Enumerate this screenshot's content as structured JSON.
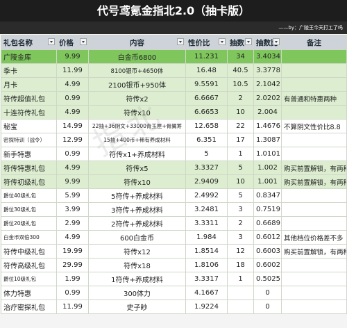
{
  "title": "代号鸢氪金指北2.0（抽卡版）",
  "credit": "——by：广陵王今天打工了吗",
  "headers": [
    "礼包名称",
    "价格",
    "内容",
    "性价比",
    "抽数",
    "抽数比",
    "备注"
  ],
  "rows": [
    {
      "name": "广陵金库",
      "price": "9.99",
      "content": "白金币6800",
      "value": "11.231",
      "pulls": "34",
      "ratio": "3.4034",
      "note": "",
      "style": "hl"
    },
    {
      "name": "季卡",
      "price": "11.99",
      "content": "8100银币+4650体",
      "value": "16.48",
      "pulls": "40.5",
      "ratio": "3.3778",
      "note": "",
      "style": "g"
    },
    {
      "name": "月卡",
      "price": "4.99",
      "content": "2100银币+950体",
      "value": "9.5591",
      "pulls": "10.5",
      "ratio": "2.1042",
      "note": "",
      "style": "g"
    },
    {
      "name": "符传超值礼包",
      "price": "0.99",
      "content": "符传x2",
      "value": "6.6667",
      "pulls": "2",
      "ratio": "2.0202",
      "note": "有普通和特惠两种",
      "style": "g"
    },
    {
      "name": "十连符传礼包",
      "price": "4.99",
      "content": "符传x10",
      "value": "6.6653",
      "pulls": "10",
      "ratio": "2.004",
      "note": "",
      "style": "g"
    },
    {
      "name": "秘宝",
      "price": "14.99",
      "content": "22抽+36阴文+33000青玉匣+骨翼筹",
      "value": "12.658",
      "pulls": "22",
      "ratio": "1.4676",
      "note": "不算阴文性价比8.8",
      "style": "w"
    },
    {
      "name": "密探特训（战令）",
      "price": "12.99",
      "content": "15抽+400币+稀有养成材料",
      "value": "6.351",
      "pulls": "17",
      "ratio": "1.3087",
      "note": "",
      "style": "w"
    },
    {
      "name": "新手特惠",
      "price": "0.99",
      "content": "符传x1+养成材料",
      "value": "5",
      "pulls": "1",
      "ratio": "1.0101",
      "note": "",
      "style": "w"
    },
    {
      "name": "符传特惠礼包",
      "price": "4.99",
      "content": "符传x5",
      "value": "3.3327",
      "pulls": "5",
      "ratio": "1.002",
      "note": "购买前置解锁，有两种",
      "style": "g"
    },
    {
      "name": "符传初级礼包",
      "price": "9.99",
      "content": "符传x10",
      "value": "2.9409",
      "pulls": "10",
      "ratio": "1.001",
      "note": "购买前置解锁，有两种",
      "style": "g"
    },
    {
      "name": "爵位40级礼包",
      "price": "5.99",
      "content": "5符传+养成材料",
      "value": "2.4992",
      "pulls": "5",
      "ratio": "0.8347",
      "note": "",
      "style": "w"
    },
    {
      "name": "爵位30级礼包",
      "price": "3.99",
      "content": "3符传+养成材料",
      "value": "3.2481",
      "pulls": "3",
      "ratio": "0.7519",
      "note": "",
      "style": "w"
    },
    {
      "name": "爵位20级礼包",
      "price": "2.99",
      "content": "2符传+养成材料",
      "value": "3.3311",
      "pulls": "2",
      "ratio": "0.6689",
      "note": "",
      "style": "w"
    },
    {
      "name": "白金币双倍300",
      "price": "4.99",
      "content": "600白金币",
      "value": "1.984",
      "pulls": "3",
      "ratio": "0.6012",
      "note": "其他档位价格差不多",
      "style": "w"
    },
    {
      "name": "符传中级礼包",
      "price": "19.99",
      "content": "符传x12",
      "value": "1.8514",
      "pulls": "12",
      "ratio": "0.6003",
      "note": "购买前置解锁，有两种",
      "style": "w"
    },
    {
      "name": "符传高级礼包",
      "price": "29.99",
      "content": "符传x18",
      "value": "1.8106",
      "pulls": "18",
      "ratio": "0.6002",
      "note": "",
      "style": "w"
    },
    {
      "name": "爵位10级礼包",
      "price": "1.99",
      "content": "1符传+养成材料",
      "value": "3.3317",
      "pulls": "1",
      "ratio": "0.5025",
      "note": "",
      "style": "w"
    },
    {
      "name": "体力特惠",
      "price": "0.99",
      "content": "300体力",
      "value": "4.1667",
      "pulls": "",
      "ratio": "0",
      "note": "",
      "style": "w"
    },
    {
      "name": "治疗密探礼包",
      "price": "11.99",
      "content": "史子眇",
      "value": "1.9224",
      "pulls": "",
      "ratio": "0",
      "note": "",
      "style": "w"
    }
  ]
}
